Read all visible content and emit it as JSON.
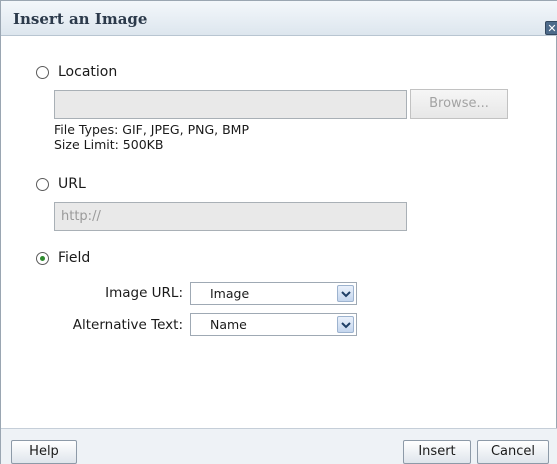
{
  "dialog": {
    "title": "Insert an Image",
    "close_icon": "close-icon"
  },
  "location": {
    "label": "Location",
    "selected": false,
    "file_value": "",
    "browse_label": "Browse...",
    "file_types": "File Types: GIF, JPEG, PNG, BMP",
    "size_limit": "Size Limit: 500KB"
  },
  "url": {
    "label": "URL",
    "selected": false,
    "placeholder": "http://"
  },
  "field": {
    "label": "Field",
    "selected": true,
    "image_url_label": "Image URL:",
    "image_url_value": "Image",
    "alt_text_label": "Alternative Text:",
    "alt_text_value": "Name"
  },
  "footer": {
    "help_label": "Help",
    "insert_label": "Insert",
    "cancel_label": "Cancel"
  },
  "colors": {
    "selected_radio": "#2f8a2f",
    "title_text": "#2c3a4b"
  }
}
